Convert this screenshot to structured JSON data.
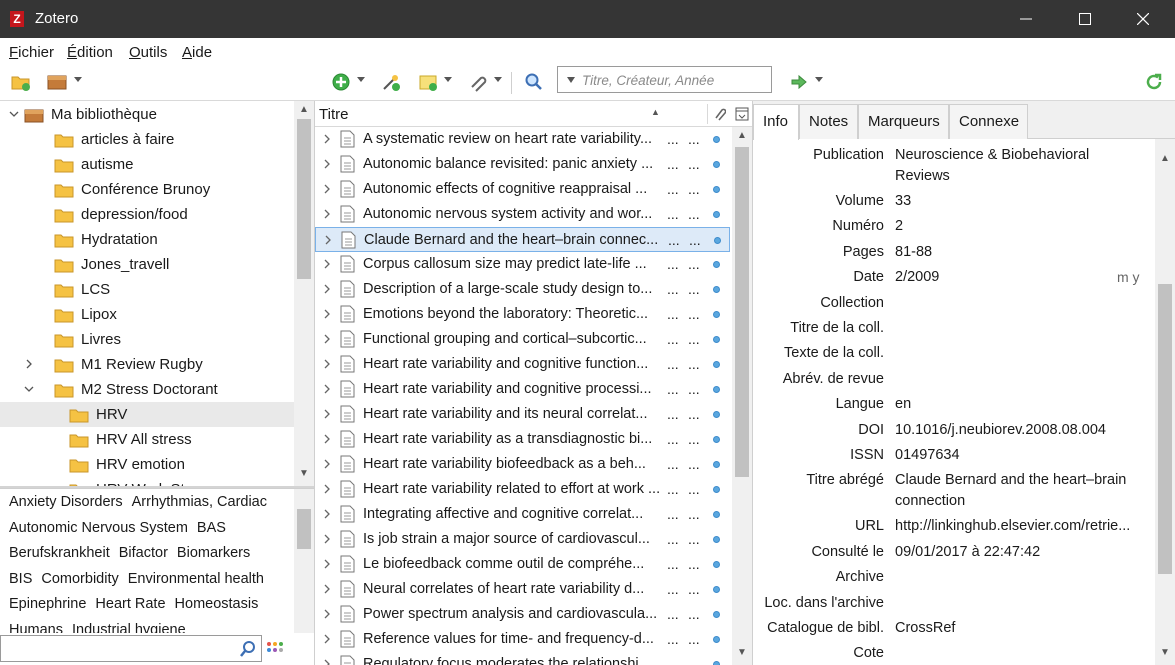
{
  "window": {
    "title": "Zotero"
  },
  "menu": [
    {
      "label": "Fichier",
      "u": "F",
      "rest": "ichier"
    },
    {
      "label": "Édition",
      "u": "É",
      "rest": "dition"
    },
    {
      "label": "Outils",
      "u": "O",
      "rest": "utils"
    },
    {
      "label": "Aide",
      "u": "A",
      "rest": "ide"
    }
  ],
  "search": {
    "placeholder": "Titre, Créateur, Année"
  },
  "collections": [
    {
      "label": "Ma bibliothèque",
      "indent": 0,
      "twisty": "down",
      "type": "library"
    },
    {
      "label": "articles à faire",
      "indent": 1,
      "twisty": ""
    },
    {
      "label": "autisme",
      "indent": 1,
      "twisty": ""
    },
    {
      "label": "Conférence Brunoy",
      "indent": 1,
      "twisty": ""
    },
    {
      "label": "depression/food",
      "indent": 1,
      "twisty": ""
    },
    {
      "label": "Hydratation",
      "indent": 1,
      "twisty": ""
    },
    {
      "label": "Jones_travell",
      "indent": 1,
      "twisty": ""
    },
    {
      "label": "LCS",
      "indent": 1,
      "twisty": ""
    },
    {
      "label": "Lipox",
      "indent": 1,
      "twisty": ""
    },
    {
      "label": "Livres",
      "indent": 1,
      "twisty": ""
    },
    {
      "label": "M1 Review Rugby",
      "indent": 1,
      "twisty": "right"
    },
    {
      "label": "M2 Stress Doctorant",
      "indent": 1,
      "twisty": "down"
    },
    {
      "label": "HRV",
      "indent": 2,
      "twisty": "",
      "selected": true
    },
    {
      "label": "HRV All stress",
      "indent": 2,
      "twisty": ""
    },
    {
      "label": "HRV emotion",
      "indent": 2,
      "twisty": ""
    },
    {
      "label": "HRV Work Stress",
      "indent": 2,
      "twisty": ""
    }
  ],
  "tags": [
    [
      "Anxiety Disorders",
      "Arrhythmias, Cardiac"
    ],
    [
      "Autonomic Nervous System",
      "BAS"
    ],
    [
      "Berufskrankheit",
      "Bifactor",
      "Biomarkers"
    ],
    [
      "BIS",
      "Comorbidity",
      "Environmental health"
    ],
    [
      "Epinephrine",
      "Heart Rate",
      "Homeostasis"
    ],
    [
      "Humans",
      "Industrial hygiene"
    ]
  ],
  "items_header": {
    "title": "Titre"
  },
  "items": [
    {
      "title": "A systematic review on heart rate variability..."
    },
    {
      "title": "Autonomic balance revisited: panic anxiety ..."
    },
    {
      "title": "Autonomic effects of cognitive reappraisal ..."
    },
    {
      "title": "Autonomic nervous system activity and wor..."
    },
    {
      "title": "Claude Bernard and the heart–brain connec...",
      "selected": true
    },
    {
      "title": "Corpus callosum size may predict late-life ..."
    },
    {
      "title": "Description of a large-scale study design to..."
    },
    {
      "title": "Emotions beyond the laboratory: Theoretic..."
    },
    {
      "title": "Functional grouping and cortical–subcortic..."
    },
    {
      "title": "Heart rate variability and cognitive function..."
    },
    {
      "title": "Heart rate variability and cognitive processi..."
    },
    {
      "title": "Heart rate variability and its neural correlat..."
    },
    {
      "title": "Heart rate variability as a transdiagnostic bi..."
    },
    {
      "title": "Heart rate variability biofeedback as a beh..."
    },
    {
      "title": "Heart rate variability related to effort at work ..."
    },
    {
      "title": "Integrating affective and cognitive correlat..."
    },
    {
      "title": "Is job strain a major source of cardiovascul..."
    },
    {
      "title": "Le biofeedback comme outil de compréhe..."
    },
    {
      "title": "Neural correlates of heart rate variability d..."
    },
    {
      "title": "Power spectrum analysis and cardiovascula..."
    },
    {
      "title": "Reference values for time- and frequency-d..."
    },
    {
      "title": "Regulatory focus moderates the relationshi..."
    }
  ],
  "item_cols": {
    "dots": "..."
  },
  "tabs": [
    "Info",
    "Notes",
    "Marqueurs",
    "Connexe"
  ],
  "fields": [
    {
      "label": "Publication",
      "value": "Neuroscience & Biobehavioral Reviews",
      "lines": 2
    },
    {
      "label": "Volume",
      "value": "33"
    },
    {
      "label": "Numéro",
      "value": "2"
    },
    {
      "label": "Pages",
      "value": "81-88"
    },
    {
      "label": "Date",
      "value": "2/2009",
      "extra": "m y"
    },
    {
      "label": "Collection",
      "value": ""
    },
    {
      "label": "Titre de la coll.",
      "value": ""
    },
    {
      "label": "Texte de la coll.",
      "value": ""
    },
    {
      "label": "Abrév. de revue",
      "value": ""
    },
    {
      "label": "Langue",
      "value": "en"
    },
    {
      "label": "DOI",
      "value": "10.1016/j.neubiorev.2008.08.004"
    },
    {
      "label": "ISSN",
      "value": "01497634"
    },
    {
      "label": "Titre abrégé",
      "value": "Claude Bernard and the heart–brain connection",
      "lines": 2
    },
    {
      "label": "URL",
      "value": "http://linkinghub.elsevier.com/retrie..."
    },
    {
      "label": "Consulté le",
      "value": "09/01/2017 à 22:47:42"
    },
    {
      "label": "Archive",
      "value": ""
    },
    {
      "label": "Loc. dans l'archive",
      "value": ""
    },
    {
      "label": "Catalogue de bibl.",
      "value": "CrossRef"
    },
    {
      "label": "Cote",
      "value": ""
    }
  ],
  "colors": {
    "titlebar": "#353535",
    "selection": "#ddeaf8",
    "accent": "#5aa7df"
  }
}
